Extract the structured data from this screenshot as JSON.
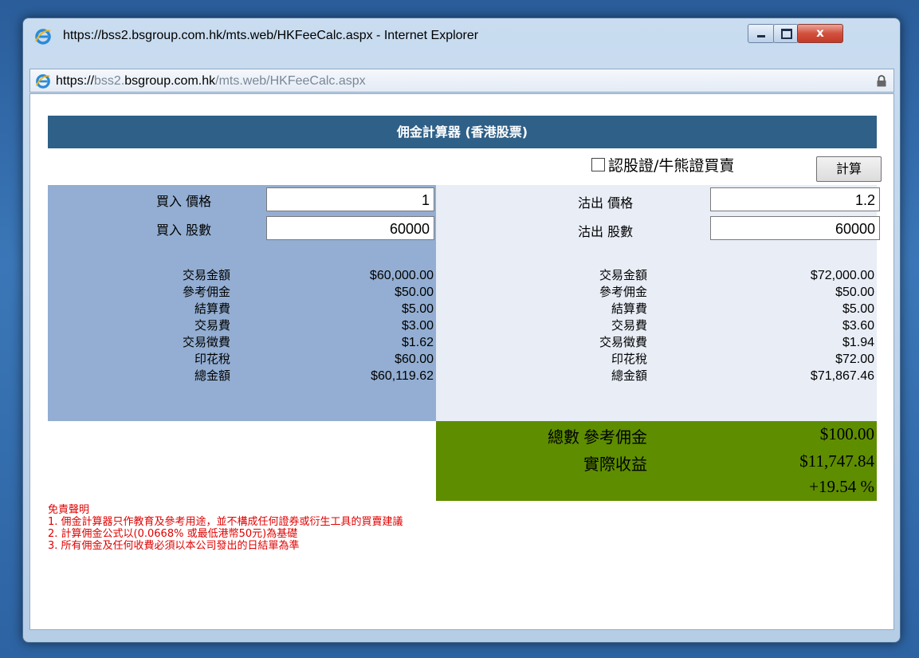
{
  "window": {
    "title": "https://bss2.bsgroup.com.hk/mts.web/HKFeeCalc.aspx - Internet Explorer",
    "close_symbol": "x"
  },
  "address": {
    "scheme": "https://",
    "sub": "bss2.",
    "domain": "bsgroup.com.hk",
    "path": "/mts.web/HKFeeCalc.aspx"
  },
  "page": {
    "header": "佣金計算器 (香港股票)",
    "warrant_label": "認股證/牛熊證買賣",
    "warrant_checked": false,
    "calc_button": "計算"
  },
  "buy": {
    "price_label": "買入 價格",
    "qty_label": "買入 股數",
    "price": "1",
    "qty": "60000",
    "rows": [
      {
        "label": "交易金額",
        "value": "$60,000.00"
      },
      {
        "label": "參考佣金",
        "value": "$50.00"
      },
      {
        "label": "結算費",
        "value": "$5.00"
      },
      {
        "label": "交易費",
        "value": "$3.00"
      },
      {
        "label": "交易徵費",
        "value": "$1.62"
      },
      {
        "label": "印花稅",
        "value": "$60.00"
      },
      {
        "label": "總金額",
        "value": "$60,119.62"
      }
    ]
  },
  "sell": {
    "price_label": "沽出 價格",
    "qty_label": "沽出 股數",
    "price": "1.2",
    "qty": "60000",
    "rows": [
      {
        "label": "交易金額",
        "value": "$72,000.00"
      },
      {
        "label": "參考佣金",
        "value": "$50.00"
      },
      {
        "label": "結算費",
        "value": "$5.00"
      },
      {
        "label": "交易費",
        "value": "$3.60"
      },
      {
        "label": "交易徵費",
        "value": "$1.94"
      },
      {
        "label": "印花稅",
        "value": "$72.00"
      },
      {
        "label": "總金額",
        "value": "$71,867.46"
      }
    ]
  },
  "summary": {
    "total_commission_label": "總數 參考佣金",
    "total_commission": "$100.00",
    "profit_label": "實際收益",
    "profit": "$11,747.84",
    "profit_pct": "+19.54 %"
  },
  "disclaimer": {
    "title": "免責聲明",
    "lines": [
      "1. 佣金計算器只作教育及參考用途，並不構成任何證券或衍生工具的買賣建議",
      "2. 計算佣金公式以(0.0668% 或最低港幣50元)為基礎",
      "3. 所有佣金及任何收費必須以本公司發出的日結單為準"
    ]
  },
  "colors": {
    "header_bg": "#2e6088",
    "buy_bg": "#93aed2",
    "sell_bg": "#e8edf6",
    "summary_bg": "#5e8d00",
    "disclaimer_text": "#e00000"
  }
}
